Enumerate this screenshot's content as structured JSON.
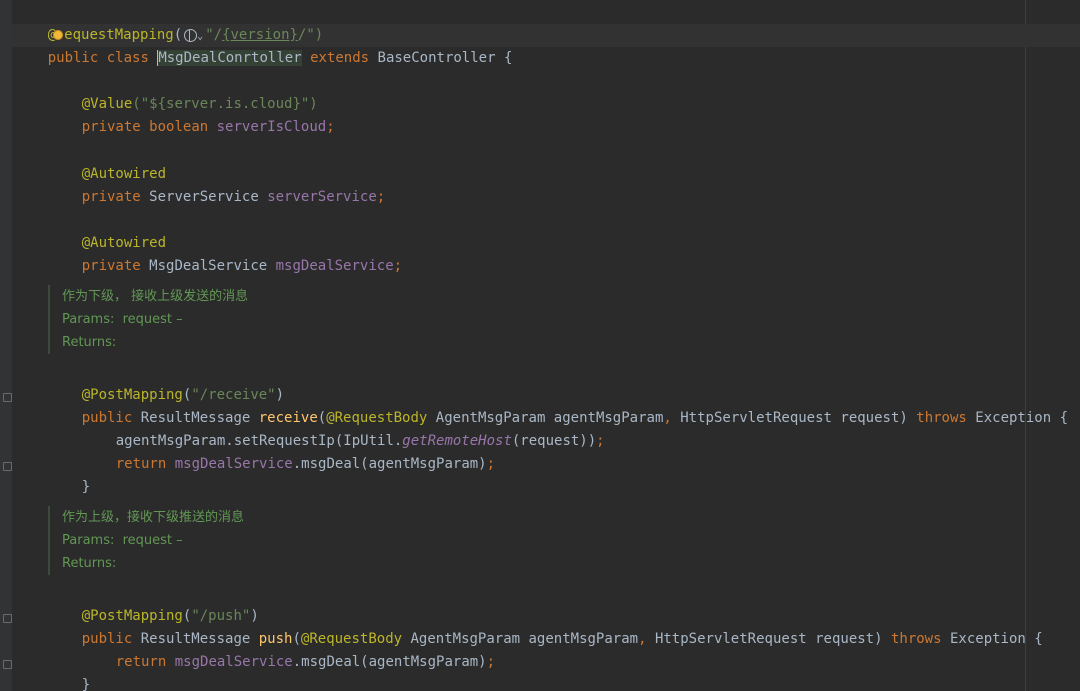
{
  "code": {
    "line1": {
      "at": "@",
      "ann_rest": "equestMapping",
      "open": "(",
      "chevron": "⌄",
      "q1": "\"/",
      "path": "{version}",
      "q2": "/\")"
    },
    "line2": {
      "public": "public",
      "class": "class",
      "classname": "MsgDealConrtoller",
      "extends": "extends",
      "base": "BaseController {"
    },
    "value_ann": "@Value",
    "value_str": "(\"${server.is.cloud}\")",
    "f1": {
      "private": "private",
      "type": "boolean",
      "name": "serverIsCloud",
      "semi": ";"
    },
    "autowired1": "@Autowired",
    "f2": {
      "private": "private",
      "type": "ServerService",
      "name": "serverService",
      "semi": ";"
    },
    "autowired2": "@Autowired",
    "f3": {
      "private": "private",
      "type": "MsgDealService",
      "name": "msgDealService",
      "semi": ";"
    },
    "doc1": {
      "text": "作为下级， 接收上级发送的消息",
      "params": "Params:  request –",
      "returns": "Returns:"
    },
    "post1": {
      "ann": "@PostMapping",
      "open": "(",
      "str": "\"/receive\"",
      "close": ")"
    },
    "m1": {
      "public": "public",
      "type": "ResultMessage",
      "name": "receive",
      "open": "(",
      "rb": "@RequestBody",
      "p1": "AgentMsgParam agentMsgParam",
      "comma": ",",
      "p2": "HttpServletRequest request)",
      "throws": "throws",
      "exc": "Exception {"
    },
    "s1": {
      "a": "agentMsgParam.setRequestIp(IpUtil.",
      "b": "getRemoteHost",
      "c": "(request))",
      "semi": ";"
    },
    "s2": {
      "ret": "return",
      "fld": "msgDealService",
      "rest": ".msgDeal(agentMsgParam)",
      "semi": ";"
    },
    "close1": "}",
    "doc2": {
      "text": "作为上级，接收下级推送的消息",
      "params": "Params:  request –",
      "returns": "Returns:"
    },
    "post2": {
      "ann": "@PostMapping",
      "open": "(",
      "str": "\"/push\"",
      "close": ")"
    },
    "m2": {
      "public": "public",
      "type": "ResultMessage",
      "name": "push",
      "open": "(",
      "rb": "@RequestBody",
      "p1": "AgentMsgParam agentMsgParam",
      "comma": ",",
      "p2": "HttpServletRequest request)",
      "throws": "throws",
      "exc": "Exception {"
    },
    "s3": {
      "ret": "return",
      "fld": "msgDealService",
      "rest": ".msgDeal(agentMsgParam)",
      "semi": ";"
    },
    "close2": "}"
  },
  "icons": {
    "bulb": "lightbulb-icon",
    "globe": "globe-icon",
    "fold": "fold-marker-icon"
  },
  "colors": {
    "background": "#2b2b2b",
    "keyword": "#cc7832",
    "annotation": "#bbb529",
    "string": "#6a8759",
    "field": "#9876aa",
    "method": "#ffc66d",
    "text": "#a9b7c6",
    "doc": "#629755"
  }
}
